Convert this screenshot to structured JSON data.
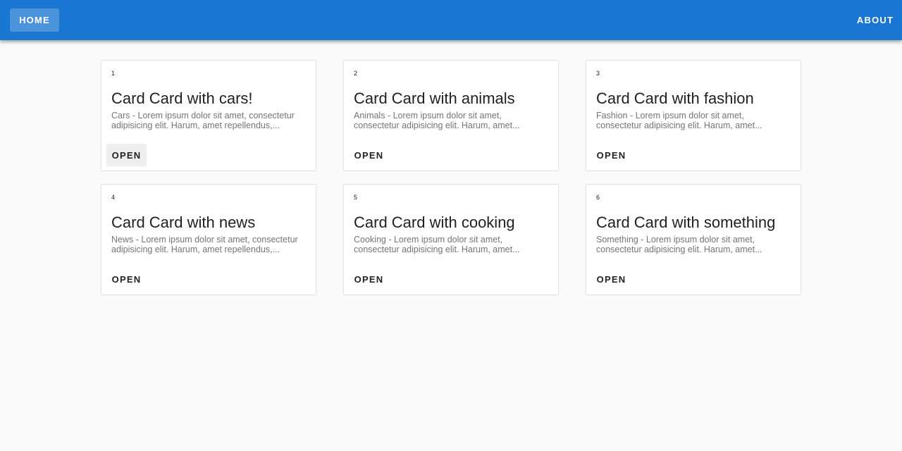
{
  "nav": {
    "home_label": "HOME",
    "about_label": "ABOUT"
  },
  "colors": {
    "appbar": "#1976d2",
    "background": "#fafafa"
  },
  "cards": [
    {
      "number": "1",
      "title": "Card Card with cars!",
      "description": "Cars - Lorem ipsum dolor sit amet, consectetur adipisicing elit. Harum, amet repellendus,...",
      "action": "OPEN"
    },
    {
      "number": "2",
      "title": "Card Card with animals",
      "description": "Animals - Lorem ipsum dolor sit amet, consectetur adipisicing elit. Harum, amet...",
      "action": "OPEN"
    },
    {
      "number": "3",
      "title": "Card Card with fashion",
      "description": "Fashion - Lorem ipsum dolor sit amet, consectetur adipisicing elit. Harum, amet...",
      "action": "OPEN"
    },
    {
      "number": "4",
      "title": "Card Card with news",
      "description": "News - Lorem ipsum dolor sit amet, consectetur adipisicing elit. Harum, amet repellendus,...",
      "action": "OPEN"
    },
    {
      "number": "5",
      "title": "Card Card with cooking",
      "description": "Cooking - Lorem ipsum dolor sit amet, consectetur adipisicing elit. Harum, amet...",
      "action": "OPEN"
    },
    {
      "number": "6",
      "title": "Card Card with something",
      "description": "Something - Lorem ipsum dolor sit amet, consectetur adipisicing elit. Harum, amet...",
      "action": "OPEN"
    }
  ]
}
